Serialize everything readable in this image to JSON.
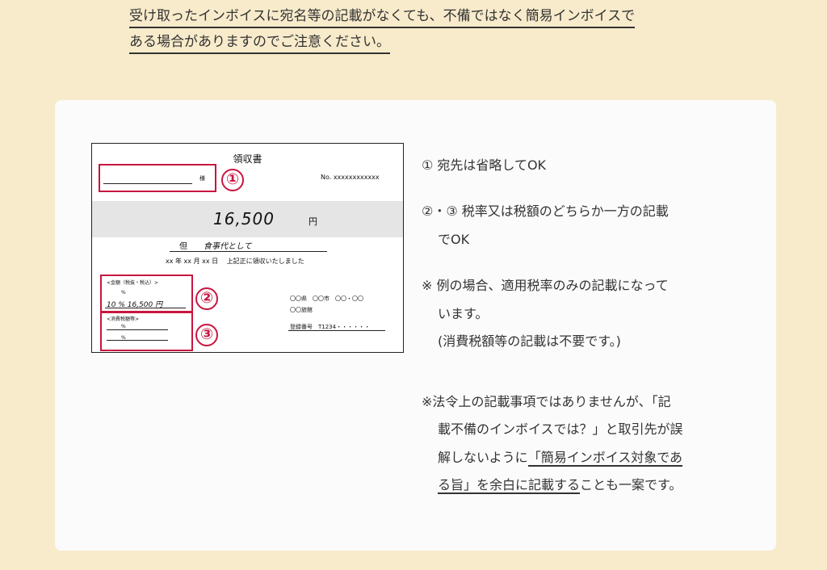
{
  "intro": {
    "line1": "受け取ったインボイスに宛名等の記載がなくても、不備ではなく簡易インボイスで",
    "line2": "ある場合がありますのでご注意ください。"
  },
  "receipt": {
    "title": "領収書",
    "honorific": "様",
    "number": "No. xxxxxxxxxxxx",
    "amount": "16,500",
    "yen": "円",
    "tadashi": "但",
    "purpose": "食事代として",
    "date_line": "xx 年 xx 月 xx 日　 上記正に領収いたしました",
    "tax_label": "<金額（税抜・税込）>",
    "percent_blank": "%",
    "rate_amount": "10 % 16,500 円",
    "consumption_label": "<消費税額等>",
    "percent_a": "%",
    "percent_b": "%",
    "address": "〇〇県　〇〇市　〇〇・〇〇",
    "shop": "〇〇旅館",
    "registration": "登録番号　T1234・・・・・・",
    "markers": [
      "①",
      "②",
      "③"
    ]
  },
  "notes": {
    "n1": "① 宛先は省略してOK",
    "n2a": "②・③ 税率又は税額のどちらか一方の記載",
    "n2b": "でOK",
    "n3a": "※ 例の場合、適用税率のみの記載になって",
    "n3b": "います。",
    "n3c": "(消費税額等の記載は不要です。)",
    "n4a": "※法令上の記載事項ではありませんが、「記",
    "n4b": "載不備のインボイスでは？」と取引先が誤",
    "n4c_pre": "解しないように",
    "n4c_ul": "「簡易インボイス対象であ",
    "n4d_ul": "る旨」を余白に記載する",
    "n4d_post": "ことも一案です。"
  }
}
